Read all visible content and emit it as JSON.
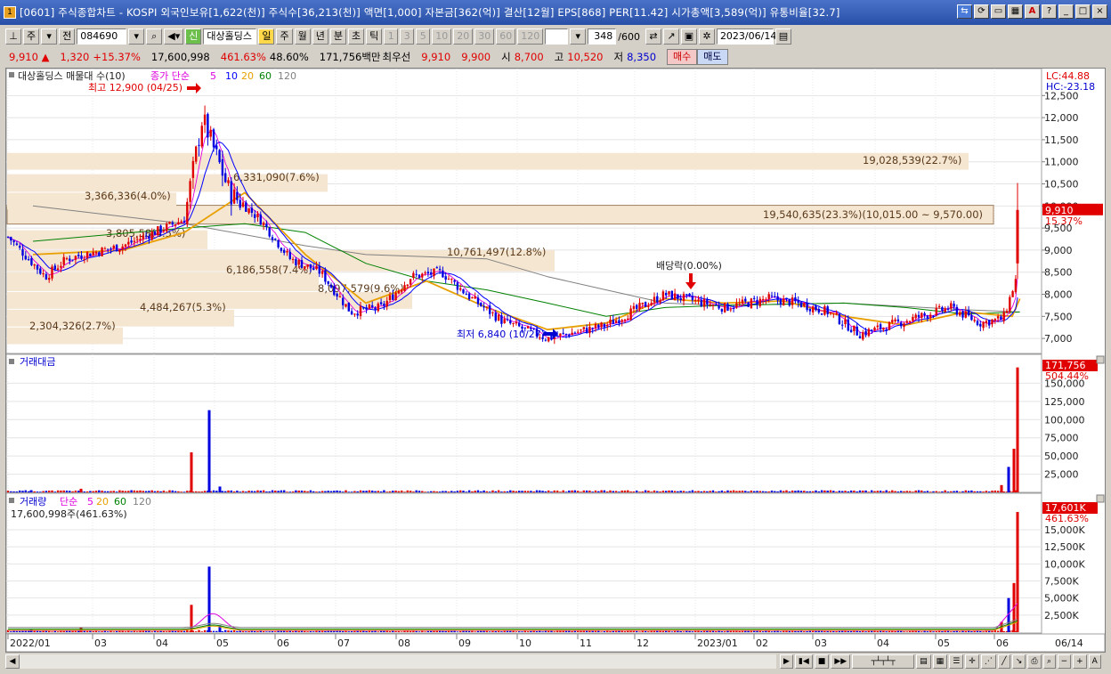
{
  "window": {
    "title": "[0601] 주식종합차트 - KOSPI 외국인보유[1,622(천)] 주식수[36,213(천)] 액면[1,000] 자본금[362(억)] 결산[12월] EPS[868] PER[11.42] 시가총액[3,589(억)] 유통비율[32.7]",
    "app_icon": "1"
  },
  "toolbar": {
    "type_select": "주",
    "jeon_label": "전",
    "code": "084690",
    "new_label": "신",
    "stock_name": "대상홀딩스",
    "yellow_btn": "일",
    "periods": [
      "주",
      "월",
      "년",
      "분",
      "초",
      "틱"
    ],
    "intervals": [
      "1",
      "3",
      "5",
      "10",
      "20",
      "30",
      "60",
      "120"
    ],
    "count": "348",
    "count_total": "/600",
    "date": "2023/06/14"
  },
  "quote": {
    "price": "9,910",
    "change": "1,320",
    "change_pct": "+15.37%",
    "volume": "17,600,998",
    "volume_pct": "461.63%",
    "turnover": "48.60%",
    "amount": "171,756백만",
    "best_label": "최우선",
    "ask": "9,910",
    "bid": "9,900",
    "open_label": "시",
    "open": "8,700",
    "high_label": "고",
    "high": "10,520",
    "low_label": "저",
    "low": "8,350",
    "buy_label": "매수",
    "sell_label": "매도"
  },
  "price_panel": {
    "legend_name": "대상홀딩스 매물대 수(10)",
    "legend_ma": "종가 단순",
    "ma_periods": [
      "5",
      "10",
      "20",
      "60",
      "120"
    ],
    "lc": "LC:44.88",
    "hc": "HC:-23.18",
    "y_ticks": [
      "12,500",
      "12,000",
      "11,500",
      "11,000",
      "10,500",
      "10,000",
      "9,500",
      "9,000",
      "8,500",
      "8,000",
      "7,500",
      "7,000"
    ],
    "y_tick_values": [
      12500,
      12000,
      11500,
      11000,
      10500,
      10000,
      9500,
      9000,
      8500,
      8000,
      7500,
      7000
    ],
    "last_price": "9,910",
    "last_pct": "15.37%",
    "high_note": "최고 12,900 (04/25)",
    "low_note": "최저 6,840 (10/27)",
    "dividend_note": "배당락(0.00%)",
    "profile_labels": [
      {
        "text": "19,028,539(22.7%)",
        "share": 22.7
      },
      {
        "text": "19,540,635(23.3%)(10,015.00 ~ 9,570.00)",
        "share": 23.3
      },
      {
        "text": "6,331,090(7.6%)",
        "share": 7.6
      },
      {
        "text": "3,366,336(4.0%)",
        "share": 4.0
      },
      {
        "text": "3,805,58(4.5%)",
        "share": 4.5
      },
      {
        "text": "10,761,497(12.8%)",
        "share": 12.8
      },
      {
        "text": "6,186,558(7.4%)",
        "share": 7.4
      },
      {
        "text": "8,097,579(9.6%)",
        "share": 9.6
      },
      {
        "text": "4,484,267(5.3%)",
        "share": 5.3
      },
      {
        "text": "2,304,326(2.7%)",
        "share": 2.7
      }
    ]
  },
  "amount_panel": {
    "legend": "거래대금",
    "last": "171,756",
    "last_pct": "504.44%",
    "y_ticks": [
      "150,000",
      "125,000",
      "100,000",
      "75,000",
      "50,000",
      "25,000"
    ],
    "y_tick_values": [
      150000,
      125000,
      100000,
      75000,
      50000,
      25000
    ]
  },
  "volume_panel": {
    "legend": "거래량",
    "legend_ma": "단순",
    "ma_periods": [
      "5",
      "20",
      "60",
      "120"
    ],
    "sub": "17,600,998주(461.63%)",
    "last": "17,601K",
    "last_pct": "461.63%",
    "y_ticks": [
      "15,000K",
      "12,500K",
      "10,000K",
      "7,500K",
      "5,000K",
      "2,500K"
    ],
    "y_tick_values": [
      15000,
      12500,
      10000,
      7500,
      5000,
      2500
    ]
  },
  "x_axis": {
    "labels": [
      "2022/01",
      "03",
      "04",
      "05",
      "06",
      "07",
      "08",
      "09",
      "10",
      "11",
      "12",
      "2023/01",
      "02",
      "03",
      "04",
      "05",
      "06"
    ],
    "right_label": "06/14"
  },
  "colors": {
    "up": "#e00000",
    "down": "#0000e0",
    "ma5": "#e000e0",
    "ma10": "#0000ff",
    "ma20": "#e8a000",
    "ma60": "#008000",
    "ma120": "#808080",
    "profile": "#f5e6d2"
  },
  "chart_data": {
    "type": "candlestick",
    "title": "",
    "price_axis_range": [
      6700,
      12950
    ],
    "key_points": [
      {
        "date": "2022/04/25",
        "label": "최고",
        "value": 12900
      },
      {
        "date": "2022/10/27",
        "label": "최저",
        "value": 6840
      },
      {
        "date": "2023/06/14",
        "label": "현재가",
        "value": 9910
      }
    ],
    "close_path": [
      {
        "x": "2022/01",
        "y": 9000
      },
      {
        "x": "2022/01",
        "y": 8400
      },
      {
        "x": "2022/02",
        "y": 8800
      },
      {
        "x": "2022/02",
        "y": 8900
      },
      {
        "x": "2022/03",
        "y": 9100
      },
      {
        "x": "2022/04",
        "y": 9700
      },
      {
        "x": "2022/04/25",
        "y": 12000
      },
      {
        "x": "2022/05",
        "y": 10300
      },
      {
        "x": "2022/05",
        "y": 9700
      },
      {
        "x": "2022/06",
        "y": 8800
      },
      {
        "x": "2022/06",
        "y": 8500
      },
      {
        "x": "2022/07",
        "y": 7600
      },
      {
        "x": "2022/07",
        "y": 7700
      },
      {
        "x": "2022/08",
        "y": 8400
      },
      {
        "x": "2022/08",
        "y": 8500
      },
      {
        "x": "2022/09",
        "y": 7900
      },
      {
        "x": "2022/09",
        "y": 7400
      },
      {
        "x": "2022/10",
        "y": 7000
      },
      {
        "x": "2022/11",
        "y": 7300
      },
      {
        "x": "2022/12",
        "y": 8000
      },
      {
        "x": "2023/01",
        "y": 7700
      },
      {
        "x": "2023/02",
        "y": 7900
      },
      {
        "x": "2023/02",
        "y": 7800
      },
      {
        "x": "2023/03",
        "y": 7600
      },
      {
        "x": "2023/03",
        "y": 7100
      },
      {
        "x": "2023/04",
        "y": 7400
      },
      {
        "x": "2023/05",
        "y": 7700
      },
      {
        "x": "2023/05",
        "y": 7350
      },
      {
        "x": "2023/06",
        "y": 7450
      },
      {
        "x": "2023/06",
        "y": 8700
      },
      {
        "x": "2023/06/14",
        "y": 9910
      }
    ],
    "ma20_path": [
      {
        "x": "2022/01",
        "y": 8900
      },
      {
        "x": "2022/03",
        "y": 9000
      },
      {
        "x": "2022/04",
        "y": 9400
      },
      {
        "x": "2022/05",
        "y": 10300
      },
      {
        "x": "2022/06",
        "y": 8900
      },
      {
        "x": "2022/07",
        "y": 7800
      },
      {
        "x": "2022/08",
        "y": 8300
      },
      {
        "x": "2022/09",
        "y": 7700
      },
      {
        "x": "2022/10",
        "y": 7200
      },
      {
        "x": "2022/11",
        "y": 7350
      },
      {
        "x": "2022/12",
        "y": 7900
      },
      {
        "x": "2023/01",
        "y": 7800
      },
      {
        "x": "2023/02",
        "y": 7850
      },
      {
        "x": "2023/03",
        "y": 7500
      },
      {
        "x": "2023/04",
        "y": 7300
      },
      {
        "x": "2023/05",
        "y": 7600
      },
      {
        "x": "2023/06",
        "y": 7500
      },
      {
        "x": "2023/06/14",
        "y": 7900
      }
    ],
    "ma60_path": [
      {
        "x": "2022/01",
        "y": 9200
      },
      {
        "x": "2022/04",
        "y": 9500
      },
      {
        "x": "2022/05",
        "y": 9600
      },
      {
        "x": "2022/06",
        "y": 9400
      },
      {
        "x": "2022/07",
        "y": 8700
      },
      {
        "x": "2022/08",
        "y": 8300
      },
      {
        "x": "2022/09",
        "y": 8100
      },
      {
        "x": "2022/10",
        "y": 7800
      },
      {
        "x": "2022/11",
        "y": 7500
      },
      {
        "x": "2022/12",
        "y": 7700
      },
      {
        "x": "2023/01",
        "y": 7750
      },
      {
        "x": "2023/03",
        "y": 7800
      },
      {
        "x": "2023/04",
        "y": 7700
      },
      {
        "x": "2023/05",
        "y": 7550
      },
      {
        "x": "2023/06/14",
        "y": 7600
      }
    ],
    "ma120_path": [
      {
        "x": "2022/01",
        "y": 10000
      },
      {
        "x": "2022/04",
        "y": 9600
      },
      {
        "x": "2022/06",
        "y": 9100
      },
      {
        "x": "2022/07",
        "y": 8900
      },
      {
        "x": "2022/09",
        "y": 8800
      },
      {
        "x": "2022/10",
        "y": 8400
      },
      {
        "x": "2022/11",
        "y": 8100
      },
      {
        "x": "2022/12",
        "y": 7800
      },
      {
        "x": "2023/01",
        "y": 7750
      },
      {
        "x": "2023/03",
        "y": 7800
      },
      {
        "x": "2023/05",
        "y": 7650
      },
      {
        "x": "2023/06/14",
        "y": 7600
      }
    ],
    "amount_spikes": [
      {
        "x": "2022/01",
        "value": 3000
      },
      {
        "x": "2022/02",
        "value": 5000
      },
      {
        "x": "2022/04",
        "value": 55000
      },
      {
        "x": "2022/04",
        "value": 113000
      },
      {
        "x": "2022/05",
        "value": 8000
      },
      {
        "x": "2023/06",
        "value": 10000
      },
      {
        "x": "2023/06",
        "value": 35000
      },
      {
        "x": "2023/06",
        "value": 60000
      },
      {
        "x": "2023/06/14",
        "value": 171756
      }
    ],
    "volume_spikes_k": [
      {
        "x": "2022/01",
        "value": 400
      },
      {
        "x": "2022/02",
        "value": 700
      },
      {
        "x": "2022/04",
        "value": 4000
      },
      {
        "x": "2022/04",
        "value": 9600
      },
      {
        "x": "2022/05",
        "value": 1000
      },
      {
        "x": "2023/06",
        "value": 1500
      },
      {
        "x": "2023/06",
        "value": 5000
      },
      {
        "x": "2023/06",
        "value": 7200
      },
      {
        "x": "2023/06/14",
        "value": 17601
      }
    ],
    "amount_axis_range": [
      0,
      175000
    ],
    "volume_axis_range_k": [
      0,
      18000
    ]
  }
}
